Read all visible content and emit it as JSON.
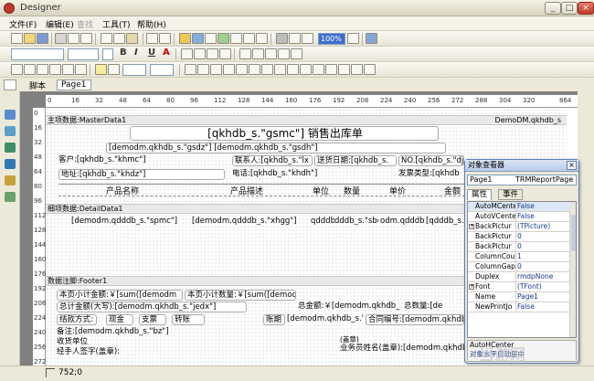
{
  "window": {
    "title": "Designer",
    "buttons": [
      "_",
      "□",
      "×"
    ]
  },
  "menu": [
    {
      "label": "文件(F)",
      "enabled": true
    },
    {
      "label": "编辑(E)",
      "enabled": true
    },
    {
      "label": "查找",
      "enabled": false
    },
    {
      "label": "工具(T)",
      "enabled": true
    },
    {
      "label": "帮助(H)",
      "enabled": true
    }
  ],
  "toolbar": {
    "zoom": "100%",
    "bold": "B",
    "italic": "I",
    "underline": "U",
    "font_color": "A"
  },
  "tabs": [
    "脚本",
    "Page1"
  ],
  "ruler": {
    "top": [
      "0",
      "16",
      "32",
      "48",
      "64",
      "80",
      "96",
      "112",
      "128",
      "144",
      "160",
      "176",
      "192",
      "208",
      "224",
      "240",
      "256",
      "272",
      "288",
      "304",
      "320"
    ],
    "top_end": "864",
    "left": [
      "0",
      "16",
      "32",
      "48",
      "64",
      "80",
      "96",
      "112",
      "128",
      "144",
      "160",
      "176",
      "192",
      "208",
      "224",
      "240",
      "256",
      "272"
    ]
  },
  "report": {
    "master_band": "主项数据:MasterData1",
    "master_source": "DemoDM.qkhdb_s",
    "title": "[qkhdb_s.\"gsmc\"] 销售出库单",
    "subtitle": "[demodm.qkhdb_s.\"gsdz\"] [demodm.qkhdb_s.\"gsdh\"]",
    "customer": "客户:[qkhdb_s.\"khmc\"]",
    "contact": "联系人:[qkhdb_s.\"lx",
    "ship_date": "送货日期:[qkhdb_s.",
    "number": "NO.[qkhdb_s.\"dj",
    "address": "地址:[qkhdb_s.\"khdz\"]",
    "phone": "电话:[qkhdb_s.\"khdh\"]",
    "invoice_type": "发票类型:[qkhdb",
    "columns": [
      "产品名称",
      "产品描述",
      "单位",
      "数量",
      "单价",
      "金额"
    ],
    "detail_band": "细项数据:DetailData1",
    "detail_fields": [
      "[demodm.qdddb_s.\"spmc\"]",
      "[demodm.qdddb_s.\"xhgg\"]",
      "qdddb",
      "dddb_s.\"sbdm",
      "odm.qdddb_s.\"",
      "[qdddb_s."
    ],
    "footer_band": "数据注脚:Footer1",
    "footer": {
      "page_total": "本页小计金额:￥[sum([demodm",
      "page_qty": "本页小计数量:￥[sum([demodm",
      "total_upper": "总计金额(大写):[demodm.qkhdb_s.\"jedx\"]",
      "total_amount": "总金额:￥[demodm.qkhdb_s.\"zj",
      "total_qty": "总数量:[de",
      "settle": "结款方式:",
      "cash": "现金",
      "check": "支票",
      "transfer": "转账",
      "credit": "账期",
      "settle_field": "[demodm.qkhdb_s.\"",
      "contract": "合同编号:[demodm.qkhdb",
      "remark": "备注:[demodm.qkhdb_s.\"bz\"]",
      "receiver": "收货单位",
      "handler": "经手人签字(盖章):",
      "seal": "(盖章)",
      "clerk": "业务员姓名(盖章):[demodm.qkhdb_s."
    }
  },
  "inspector": {
    "title": "对象查看器",
    "object": "Page1",
    "object_type": "TRMReportPage",
    "tabs": [
      "属性",
      "事件"
    ],
    "props": [
      {
        "name": "AutoMCente",
        "value": "False",
        "exp": ""
      },
      {
        "name": "AutoVCente",
        "value": "False",
        "exp": ""
      },
      {
        "name": "BackPictur",
        "value": "(TPicture)",
        "exp": "+"
      },
      {
        "name": "BackPictur",
        "value": "0",
        "exp": ""
      },
      {
        "name": "BackPictur",
        "value": "0",
        "exp": ""
      },
      {
        "name": "ColumnCoun",
        "value": "1",
        "exp": ""
      },
      {
        "name": "ColumnGap",
        "value": "0",
        "exp": ""
      },
      {
        "name": "Duplex",
        "value": "rmdpNone",
        "exp": ""
      },
      {
        "name": "Font",
        "value": "(TFont)",
        "exp": "+"
      },
      {
        "name": "Name",
        "value": "Page1",
        "exp": ""
      },
      {
        "name": "NewPrintJo",
        "value": "False",
        "exp": ""
      }
    ],
    "help_title": "AutoHCenter",
    "help_text": "对象水平自动居中"
  },
  "status": {
    "coords": "752;0"
  },
  "watermark": "当游网"
}
